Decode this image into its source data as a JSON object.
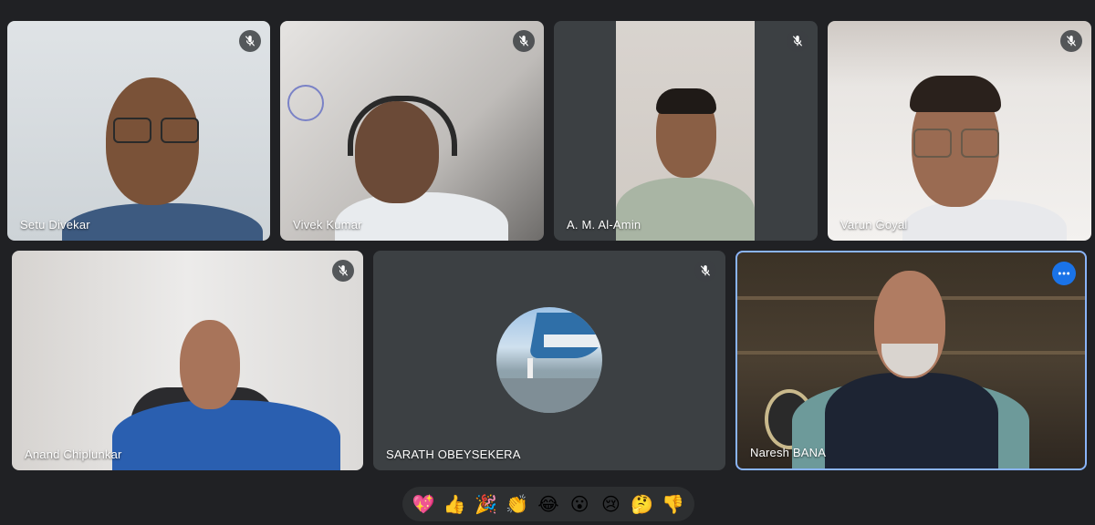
{
  "participants": [
    {
      "name": "Setu Divekar",
      "muted": true
    },
    {
      "name": "Vivek Kumar",
      "muted": true
    },
    {
      "name": "A. M. Al-Amin",
      "muted": true
    },
    {
      "name": "Varun Goyal",
      "muted": true
    },
    {
      "name": "Anand Chiplunkar",
      "muted": true
    },
    {
      "name": "SARATH OBEYSEKERA",
      "muted": true,
      "camera_off": true
    },
    {
      "name": "Naresh BANA",
      "muted": false,
      "active_speaker": true
    }
  ],
  "icons": {
    "mic_off": "mic-off-icon",
    "more": "more-options-icon"
  },
  "reactions": [
    {
      "emoji": "💖",
      "name": "sparkling-heart"
    },
    {
      "emoji": "👍",
      "name": "thumbs-up"
    },
    {
      "emoji": "🎉",
      "name": "party-popper"
    },
    {
      "emoji": "👏",
      "name": "clapping-hands"
    },
    {
      "emoji": "😂",
      "name": "tears-of-joy"
    },
    {
      "emoji": "😮",
      "name": "surprised"
    },
    {
      "emoji": "😢",
      "name": "crying"
    },
    {
      "emoji": "🤔",
      "name": "thinking"
    },
    {
      "emoji": "👎",
      "name": "thumbs-down"
    }
  ],
  "colors": {
    "background": "#202124",
    "tile": "#3c4043",
    "active_border": "#8ab4f8",
    "accent": "#1a73e8"
  }
}
